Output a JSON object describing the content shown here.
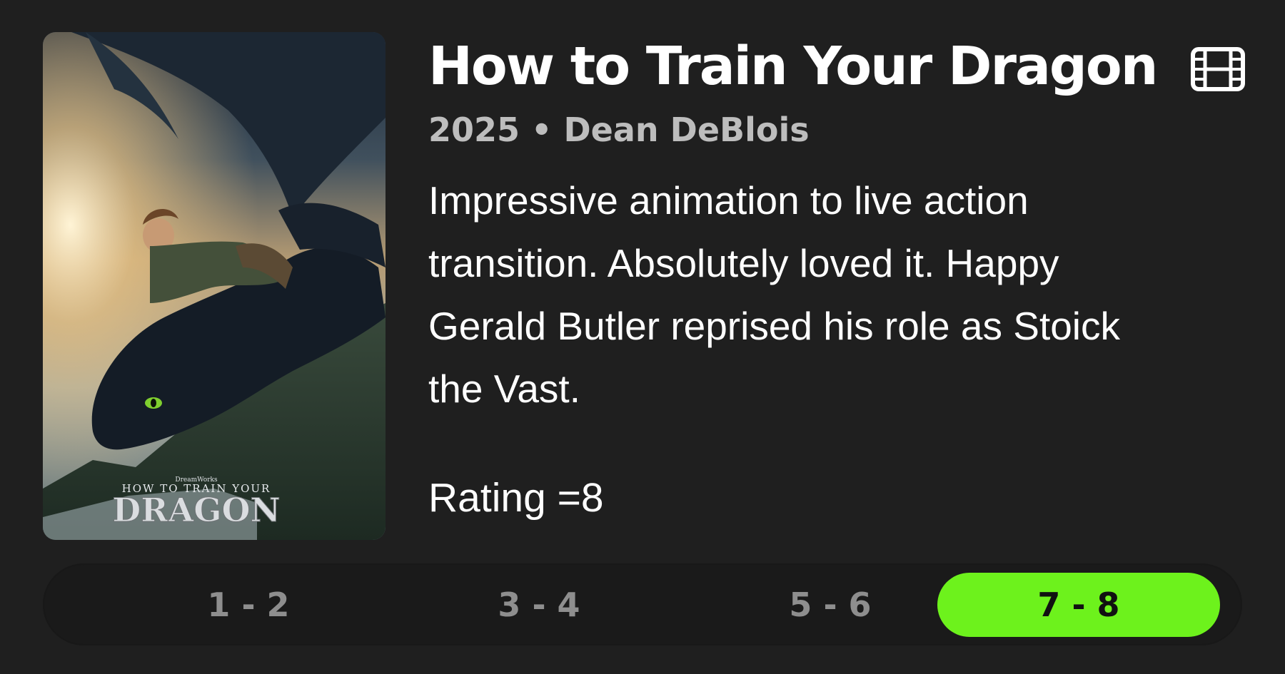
{
  "movie": {
    "title": "How to Train Your Dragon",
    "meta": "2025 • Dean DeBlois",
    "review": "Impressive animation to live action transition. Absolutely loved it. Happy Gerald Butler reprised his role as Stoick the Vast.",
    "rating": "Rating =8",
    "poster": {
      "studio_text": "DreamWorks",
      "tagline_text": "HOW TO TRAIN YOUR",
      "wordmark_text": "DRAGON"
    }
  },
  "icons": {
    "media_type": "film-icon"
  },
  "rating_ranges": {
    "options": [
      "1 - 2",
      "3 - 4",
      "5 - 6",
      "7 - 8"
    ],
    "selected": "7 - 8"
  },
  "colors": {
    "background": "#1f1f1f",
    "accent": "#6df21c",
    "meta_text": "#bdbdbd",
    "inactive_segment_text": "#8e8e8e"
  }
}
